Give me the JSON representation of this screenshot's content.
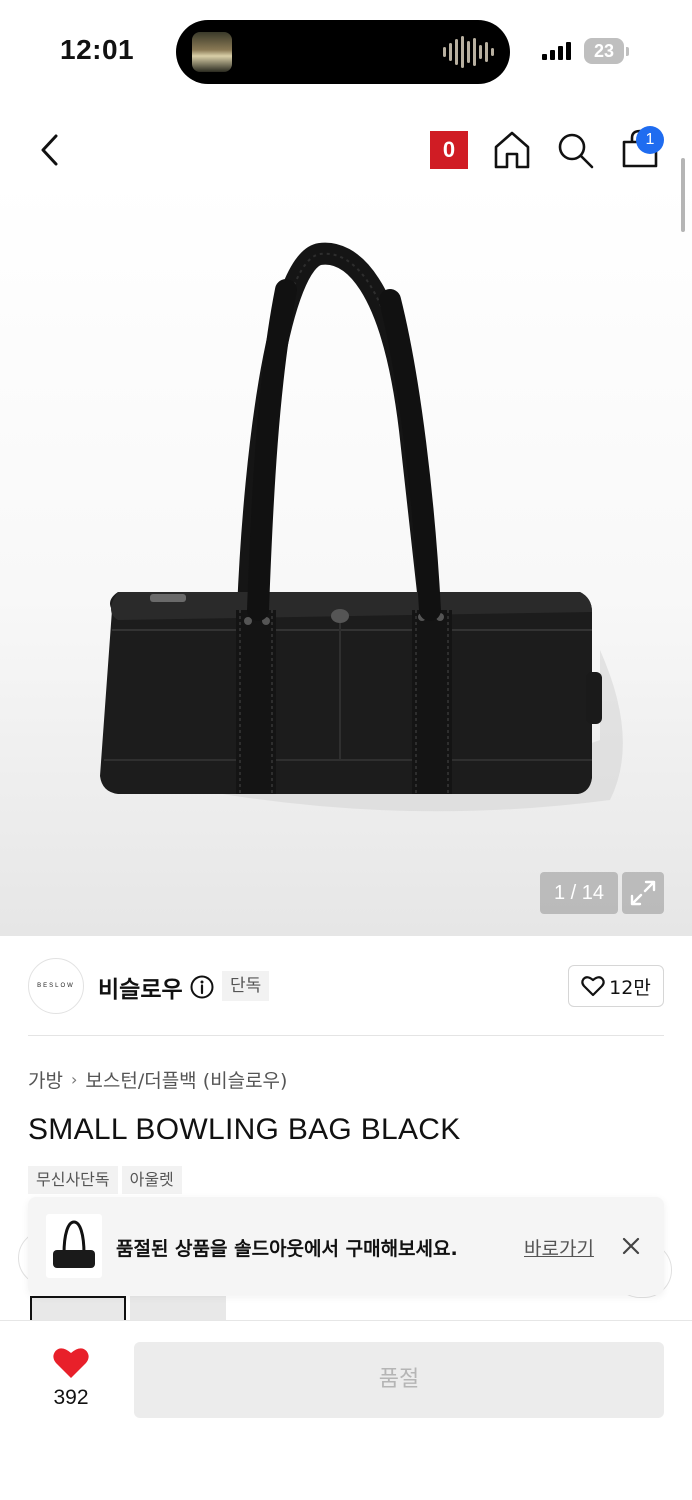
{
  "status_bar": {
    "time": "12:01",
    "battery": "23"
  },
  "header": {
    "back_icon": "chevron-left-icon",
    "point_badge": "0",
    "home_icon": "home-icon",
    "search_icon": "search-icon",
    "cart_icon": "shopping-bag-icon",
    "cart_count": "1"
  },
  "gallery": {
    "counter": "1 / 14",
    "expand_icon": "expand-arrows-icon"
  },
  "brand": {
    "logo_text": "BESLOW",
    "name": "비슬로우",
    "exclusive_label": "단독",
    "like_count": "12만"
  },
  "product": {
    "breadcrumb": [
      "가방",
      "보스턴/더플백 (비슬로우)"
    ],
    "title": "SMALL BOWLING BAG BLACK",
    "tags": [
      "무신사단독",
      "아울렛"
    ]
  },
  "toast": {
    "message": "품절된 상품을 솔드아웃에서 구매해보세요.",
    "link": "바로가기"
  },
  "bottom_bar": {
    "wish_count": "392",
    "soldout_label": "품절"
  },
  "colors": {
    "accent_red": "#d01c24",
    "badge_blue": "#1f6cf0",
    "heart_red": "#e8202a"
  }
}
